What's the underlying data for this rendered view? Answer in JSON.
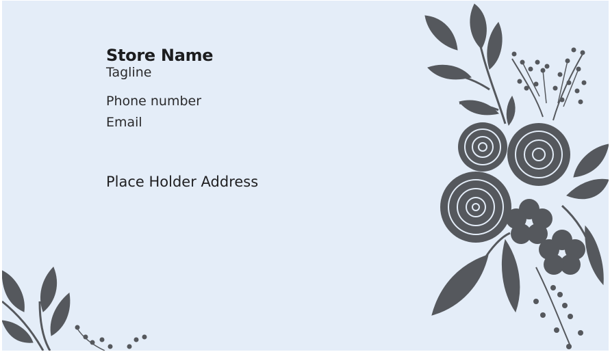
{
  "card": {
    "store_name": "Store Name",
    "tagline": "Tagline",
    "phone": "Phone number",
    "email": "Email",
    "address": "Place Holder Address"
  },
  "colors": {
    "background": "#e4edf8",
    "floral": "#55585d",
    "text": "#1c1d1f"
  },
  "decorations": [
    "floral-bouquet-illustration",
    "leaf-sprig-illustration"
  ]
}
